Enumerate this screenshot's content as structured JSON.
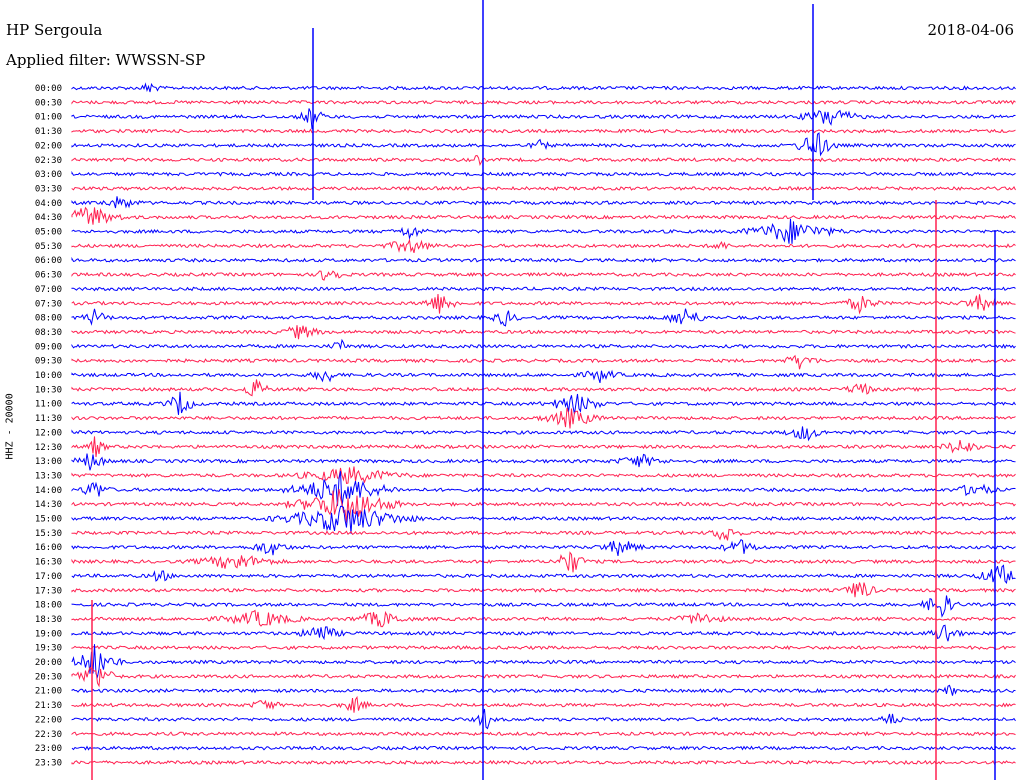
{
  "header": {
    "station": "HP Sergoula",
    "filter": "Applied filter: WWSSN-SP",
    "date": "2018-04-06"
  },
  "chart_data": {
    "type": "line",
    "ylabel": "HHZ - 20000",
    "colors": [
      "#0000ff",
      "#ff2050"
    ],
    "time_labels": [
      "00:00",
      "00:30",
      "01:00",
      "01:30",
      "02:00",
      "02:30",
      "03:00",
      "03:30",
      "04:00",
      "04:30",
      "05:00",
      "05:30",
      "06:00",
      "06:30",
      "07:00",
      "07:30",
      "08:00",
      "08:30",
      "09:00",
      "09:30",
      "10:00",
      "10:30",
      "11:00",
      "11:30",
      "12:00",
      "12:30",
      "13:00",
      "13:30",
      "14:00",
      "14:30",
      "15:00",
      "15:30",
      "16:00",
      "16:30",
      "17:00",
      "17:30",
      "18:00",
      "18:30",
      "19:00",
      "19:30",
      "20:00",
      "20:30",
      "21:00",
      "21:30",
      "22:00",
      "22:30",
      "23:00",
      "23:30"
    ]
  }
}
